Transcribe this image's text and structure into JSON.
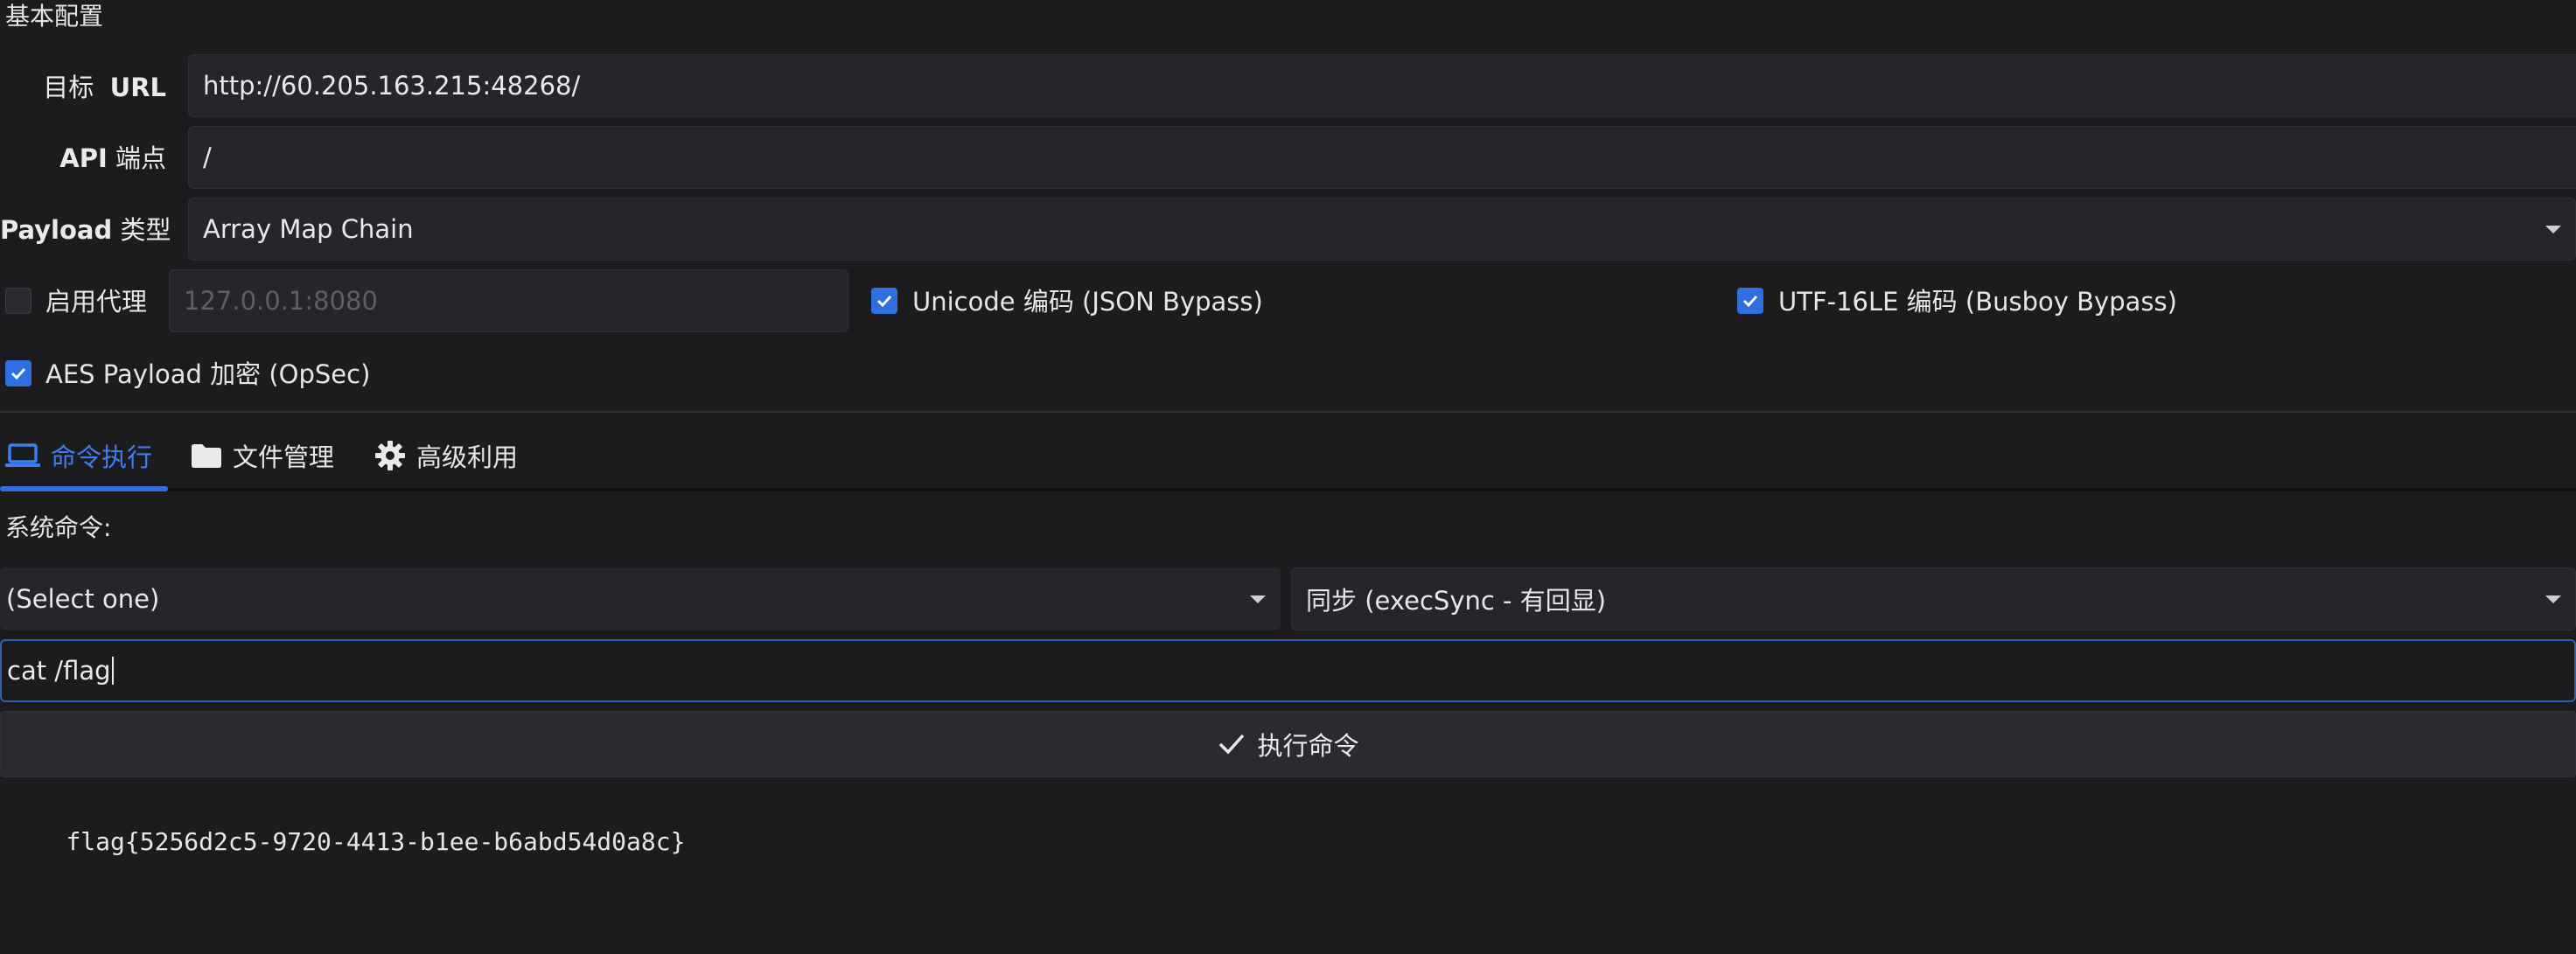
{
  "section_title": "基本配置",
  "target_url": {
    "label_prefix": "目标",
    "label_bold": "URL",
    "value": "http://60.205.163.215:48268/"
  },
  "api_endpoint": {
    "label_bold": "API",
    "label_suffix": "端点",
    "value": "/"
  },
  "payload_type": {
    "label_bold": "Payload",
    "label_suffix": "类型",
    "value": "Array Map Chain",
    "icon": "chevron-down-icon"
  },
  "proxy": {
    "checked": false,
    "label": "启用代理",
    "placeholder": "127.0.0.1:8080"
  },
  "unicode_encoding": {
    "checked": true,
    "label": "Unicode 编码  (JSON Bypass)"
  },
  "utf16_encoding": {
    "checked": true,
    "label": "UTF-16LE 编码  (Busboy Bypass)"
  },
  "aes_encryption": {
    "checked": true,
    "label": "AES Payload 加密  (OpSec)"
  },
  "tabs": [
    {
      "label": "命令执行",
      "icon": "laptop-icon",
      "active": true
    },
    {
      "label": "文件管理",
      "icon": "folder-icon",
      "active": false
    },
    {
      "label": "高级利用",
      "icon": "gear-icon",
      "active": false
    }
  ],
  "command": {
    "section_label": "系统命令:",
    "preset_select": "(Select one)",
    "mode_select": "同步  (execSync - 有回显)",
    "input_value": "cat /flag",
    "execute_label": "执行命令",
    "output": "flag{5256d2c5-9720-4413-b1ee-b6abd54d0a8c}"
  },
  "colors": {
    "accent": "#2f6fe0",
    "background": "#1c1c1f",
    "field": "#25262b"
  }
}
